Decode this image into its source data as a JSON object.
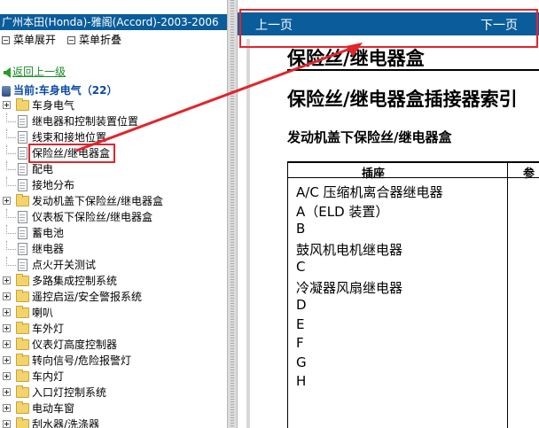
{
  "left_panel": {
    "title": "广州本田(Honda)-雅阁(Accord)-2003-2006",
    "menu": {
      "expand": "菜单展开",
      "collapse": "菜单折叠"
    },
    "back_link": "返回上一级",
    "current": "当前:车身电气（22）",
    "tree_items": [
      {
        "label": "车身电气",
        "kind": "folder"
      },
      {
        "label": "继电器和控制装置位置",
        "kind": "doc"
      },
      {
        "label": "线束和接地位置",
        "kind": "doc"
      },
      {
        "label": "保险丝/继电器盒",
        "kind": "doc"
      },
      {
        "label": "配电",
        "kind": "doc"
      },
      {
        "label": "接地分布",
        "kind": "doc"
      },
      {
        "label": "发动机盖下保险丝/继电器盒",
        "kind": "folder"
      },
      {
        "label": "仪表板下保险丝/继电器盒",
        "kind": "doc"
      },
      {
        "label": "蓄电池",
        "kind": "doc"
      },
      {
        "label": "继电器",
        "kind": "doc"
      },
      {
        "label": "点火开关测试",
        "kind": "doc"
      },
      {
        "label": "多路集成控制系统",
        "kind": "folder"
      },
      {
        "label": "遥控启运/安全警报系统",
        "kind": "folder"
      },
      {
        "label": "喇叭",
        "kind": "folder"
      },
      {
        "label": "车外灯",
        "kind": "folder"
      },
      {
        "label": "仪表灯高度控制器",
        "kind": "folder"
      },
      {
        "label": "转向信号/危险报警灯",
        "kind": "folder"
      },
      {
        "label": "车内灯",
        "kind": "folder"
      },
      {
        "label": "入口灯控制系统",
        "kind": "folder"
      },
      {
        "label": "电动车窗",
        "kind": "folder"
      },
      {
        "label": "刮水器/洗涤器",
        "kind": "folder"
      }
    ]
  },
  "right_panel": {
    "nav": {
      "prev": "上一页",
      "next": "下一页"
    },
    "heading1": "保险丝/继电器盒",
    "heading2": "保险丝/继电器盒插接器索引",
    "heading3": "发动机盖下保险丝/继电器盒",
    "table": {
      "col1": "插座",
      "col2": "参",
      "rows": [
        "A/C 压缩机离合器继电器",
        "A（ELD 装置）",
        "B",
        "鼓风机电机继电器",
        "C",
        "冷凝器风扇继电器",
        "D",
        "E",
        "F",
        "G",
        "H"
      ]
    }
  },
  "colors": {
    "title_bar": "#0a5d9a",
    "highlight": "#e0262c",
    "link_green": "#1c8a2a"
  }
}
